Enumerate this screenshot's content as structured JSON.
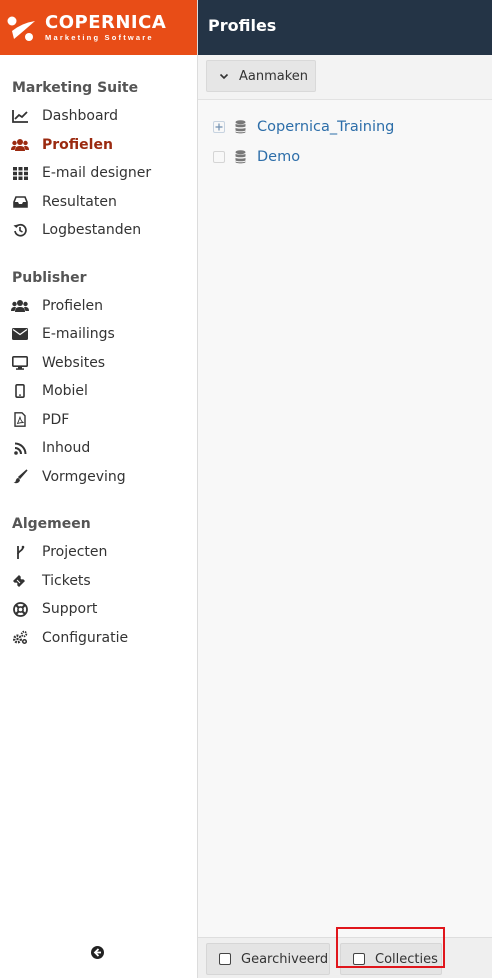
{
  "brand": {
    "title": "COPERNICA",
    "subtitle": "Marketing Software",
    "color": "#e84d17"
  },
  "header": {
    "title": "Profiles"
  },
  "toolbar": {
    "create_label": "Aanmaken"
  },
  "sidebar": {
    "sections": [
      {
        "title": "Marketing Suite",
        "items": [
          {
            "label": "Dashboard",
            "icon": "chart-line-icon"
          },
          {
            "label": "Profielen",
            "icon": "users-icon",
            "active": true
          },
          {
            "label": "E-mail designer",
            "icon": "grid-icon"
          },
          {
            "label": "Resultaten",
            "icon": "inbox-icon"
          },
          {
            "label": "Logbestanden",
            "icon": "history-icon"
          }
        ]
      },
      {
        "title": "Publisher",
        "items": [
          {
            "label": "Profielen",
            "icon": "users-icon"
          },
          {
            "label": "E-mailings",
            "icon": "envelope-icon"
          },
          {
            "label": "Websites",
            "icon": "desktop-icon"
          },
          {
            "label": "Mobiel",
            "icon": "mobile-icon"
          },
          {
            "label": "PDF",
            "icon": "pdf-icon"
          },
          {
            "label": "Inhoud",
            "icon": "rss-icon"
          },
          {
            "label": "Vormgeving",
            "icon": "brush-icon"
          }
        ]
      },
      {
        "title": "Algemeen",
        "items": [
          {
            "label": "Projecten",
            "icon": "branch-icon"
          },
          {
            "label": "Tickets",
            "icon": "ticket-icon"
          },
          {
            "label": "Support",
            "icon": "lifebuoy-icon"
          },
          {
            "label": "Configuratie",
            "icon": "cogs-icon"
          }
        ]
      }
    ]
  },
  "tree": [
    {
      "label": "Copernica_Training",
      "expandable": true
    },
    {
      "label": "Demo",
      "expandable": false
    }
  ],
  "footer": {
    "archived_label": "Gearchiveerd",
    "collections_label": "Collecties"
  },
  "colors": {
    "header_bg": "#243446",
    "link": "#2d6ea9",
    "active": "#9b2a10",
    "highlight": "#e0161c"
  }
}
